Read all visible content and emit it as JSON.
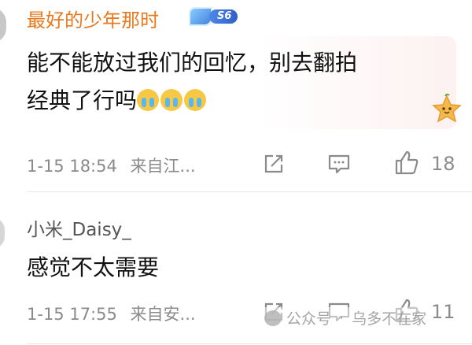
{
  "comments": [
    {
      "username": "最好的少年那时",
      "vip_level": "S6",
      "text_line1": "能不能放过我们的回忆，别去翻拍",
      "text_line2": "经典了行吗",
      "emoji_count": 3,
      "emoji_name": "crying-face",
      "timestamp": "1-15 18:54",
      "location": "来自江...",
      "likes": "18"
    },
    {
      "username": "小米_Daisy_",
      "text": "感觉不太需要",
      "timestamp": "1-15 17:55",
      "location": "来自安...",
      "likes": "11"
    }
  ],
  "watermark": {
    "source": "公众号",
    "separator": "·",
    "name": "乌多不在家"
  },
  "colors": {
    "username_accent": "#e7791f",
    "meta_gray": "#8b8b8b"
  }
}
